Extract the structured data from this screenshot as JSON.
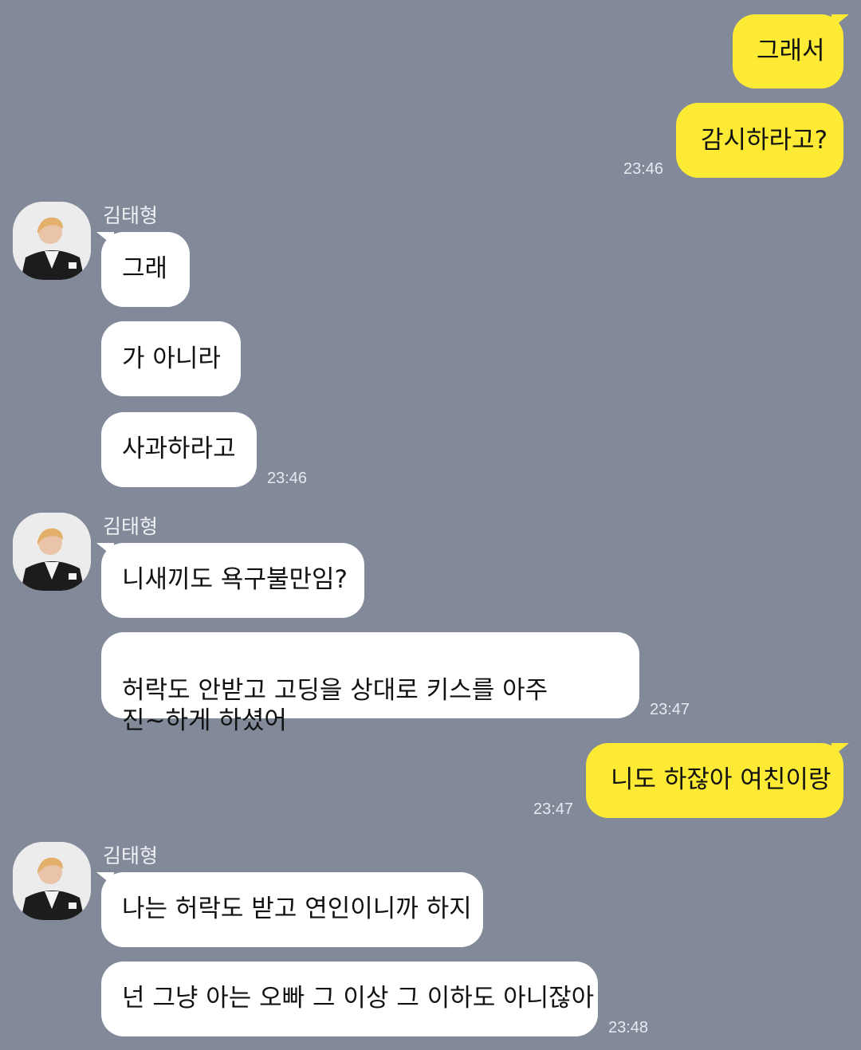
{
  "messages": [
    {
      "text": "그래서",
      "sender": "me"
    },
    {
      "text": "감시하라고?",
      "sender": "me"
    },
    {
      "text": "그래",
      "sender": "them"
    },
    {
      "text": "가 아니라",
      "sender": "them"
    },
    {
      "text": "사과하라고",
      "sender": "them"
    },
    {
      "text": "니새끼도 욕구불만임?",
      "sender": "them"
    },
    {
      "text": "허락도 안받고 고딩을 상대로 키스를 아주\n진~하게 하셨어",
      "sender": "them"
    },
    {
      "text": "니도 하잖아 여친이랑",
      "sender": "me"
    },
    {
      "text": "나는 허락도 받고 연인이니까 하지",
      "sender": "them"
    },
    {
      "text": "넌 그냥 아는 오빠 그 이상 그 이하도 아니잖아",
      "sender": "them"
    }
  ],
  "timestamps": [
    "23:46",
    "23:46",
    "23:47",
    "23:47",
    "23:48"
  ],
  "contact_name": "김태형",
  "colors": {
    "background": "#828a9a",
    "my_bubble": "#fdea35",
    "their_bubble": "#ffffff"
  },
  "icons": {
    "avatar": "profile-photo"
  }
}
